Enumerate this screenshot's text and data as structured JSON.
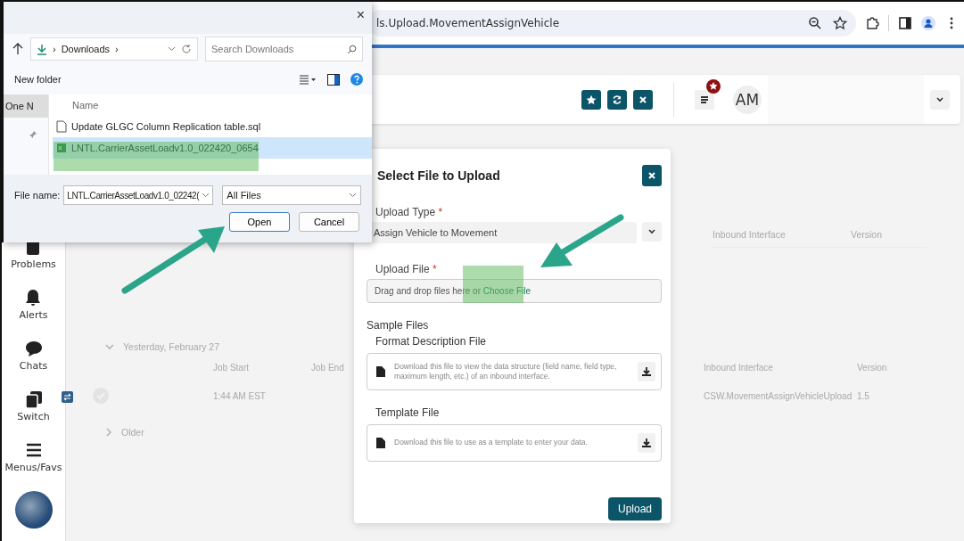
{
  "browser": {
    "url": "ls.Upload.MovementAssignVehicle"
  },
  "header": {
    "avatar_initials": "AM"
  },
  "sidebar": {
    "items": [
      {
        "label": "Problems",
        "kind": "problems"
      },
      {
        "label": "Alerts",
        "kind": "bell"
      },
      {
        "label": "Chats",
        "kind": "chat"
      },
      {
        "label": "Switch",
        "kind": "switch"
      },
      {
        "label": "Menus/Favs",
        "kind": "menu"
      }
    ]
  },
  "background": {
    "top_columns": [
      "Inbound Interface",
      "Version"
    ],
    "group": {
      "title": "Yesterday, February 27",
      "expanded": true,
      "columns": [
        "Job Start",
        "Job End",
        "Inbound Interface",
        "Version"
      ],
      "row": {
        "job_start": "1:44 AM EST",
        "inbound_interface": "CSW.MovementAssignVehicleUpload",
        "version": "1.5"
      }
    },
    "older": {
      "title": "Older",
      "expanded": false
    }
  },
  "upload_modal": {
    "title": "Select File to Upload",
    "upload_type": {
      "label": "Upload Type",
      "required_mark": "*",
      "value": "Assign Vehicle to Movement"
    },
    "upload_file": {
      "label": "Upload File",
      "required_mark": "*",
      "hint": "Drag and drop files here or ",
      "link": "Choose File"
    },
    "sample_files": {
      "title": "Sample Files",
      "files": [
        {
          "title": "Format Description File",
          "description": "Download this file to view the data structure (field name, field type, maximum length, etc.) of an inbound interface."
        },
        {
          "title": "Template File",
          "description": "Download this file to use as a template to enter your data."
        }
      ]
    },
    "submit": "Upload"
  },
  "file_dialog": {
    "close": "×",
    "breadcrumb": [
      "›",
      "Downloads",
      "›"
    ],
    "search_placeholder": "Search Downloads",
    "new_folder": "New folder",
    "nav_item": "One N",
    "column": "Name",
    "files": [
      {
        "name": "Update GLGC Column Replication table.sql",
        "kind": "text",
        "selected": false
      },
      {
        "name": "LNTL.CarrierAssetLoadv1.0_022420_0654",
        "kind": "sheet",
        "selected": true
      }
    ],
    "file_name_label": "File name:",
    "file_name": "LNTL.CarrierAssetLoadv1.0_02242(",
    "filter": "All Files",
    "buttons": [
      "Open",
      "Cancel"
    ]
  }
}
